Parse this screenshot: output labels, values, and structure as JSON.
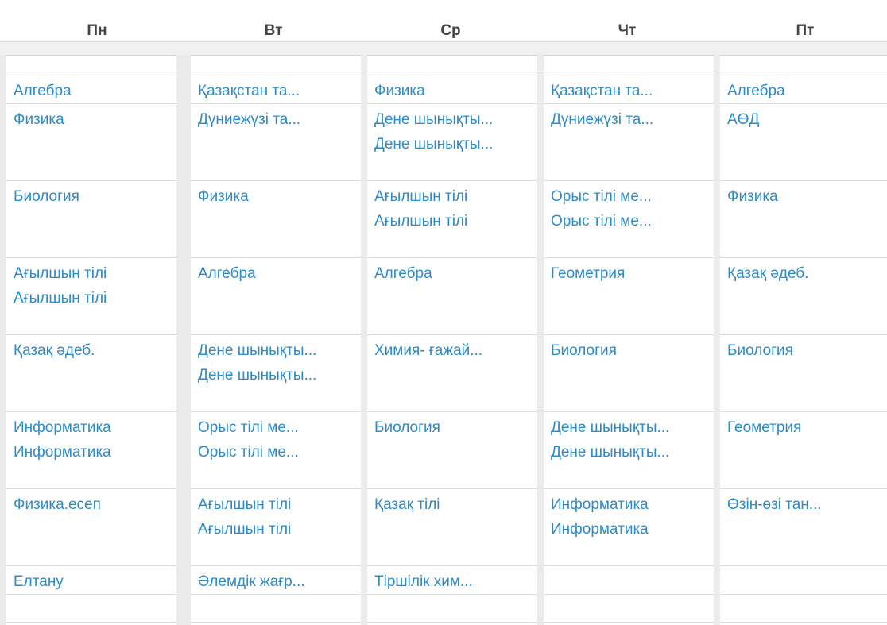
{
  "days": [
    {
      "name": "Пн",
      "lessons": [
        [
          "Алгебра"
        ],
        [
          "Физика"
        ],
        [
          "Биология"
        ],
        [
          "Ағылшын тілі",
          "Ағылшын тілі"
        ],
        [
          "Қазақ әдеб."
        ],
        [
          "Информатика",
          "Информатика"
        ],
        [
          "Физика.есеп"
        ],
        [
          "Елтану"
        ],
        []
      ]
    },
    {
      "name": "Вт",
      "lessons": [
        [
          "Қазақстан та..."
        ],
        [
          "Дүниежүзі та..."
        ],
        [
          "Физика"
        ],
        [
          "Алгебра"
        ],
        [
          "Дене шынықты...",
          "Дене шынықты..."
        ],
        [
          "Орыс тілі ме...",
          "Орыс тілі ме..."
        ],
        [
          "Ағылшын тілі",
          "Ағылшын тілі"
        ],
        [
          "Әлемдік жағр..."
        ],
        []
      ]
    },
    {
      "name": "Ср",
      "lessons": [
        [
          "Физика"
        ],
        [
          "Дене шынықты...",
          "Дене шынықты..."
        ],
        [
          "Ағылшын тілі",
          "Ағылшын тілі"
        ],
        [
          "Алгебра"
        ],
        [
          "Химия- ғажай..."
        ],
        [
          "Биология"
        ],
        [
          "Қазақ тілі"
        ],
        [
          "Тіршілік хим..."
        ],
        []
      ]
    },
    {
      "name": "Чт",
      "lessons": [
        [
          "Қазақстан та..."
        ],
        [
          "Дүниежүзі та..."
        ],
        [
          "Орыс тілі ме...",
          "Орыс тілі ме..."
        ],
        [
          "Геометрия"
        ],
        [
          "Биология"
        ],
        [
          "Дене шынықты...",
          "Дене шынықты..."
        ],
        [
          "Информатика",
          "Информатика"
        ],
        [],
        []
      ]
    },
    {
      "name": "Пт",
      "lessons": [
        [
          "Алгебра"
        ],
        [
          "АӨД"
        ],
        [
          "Физика"
        ],
        [
          "Қазақ әдеб."
        ],
        [
          "Биология"
        ],
        [
          "Геометрия"
        ],
        [
          "Өзін-өзі тан..."
        ],
        [],
        []
      ]
    }
  ]
}
